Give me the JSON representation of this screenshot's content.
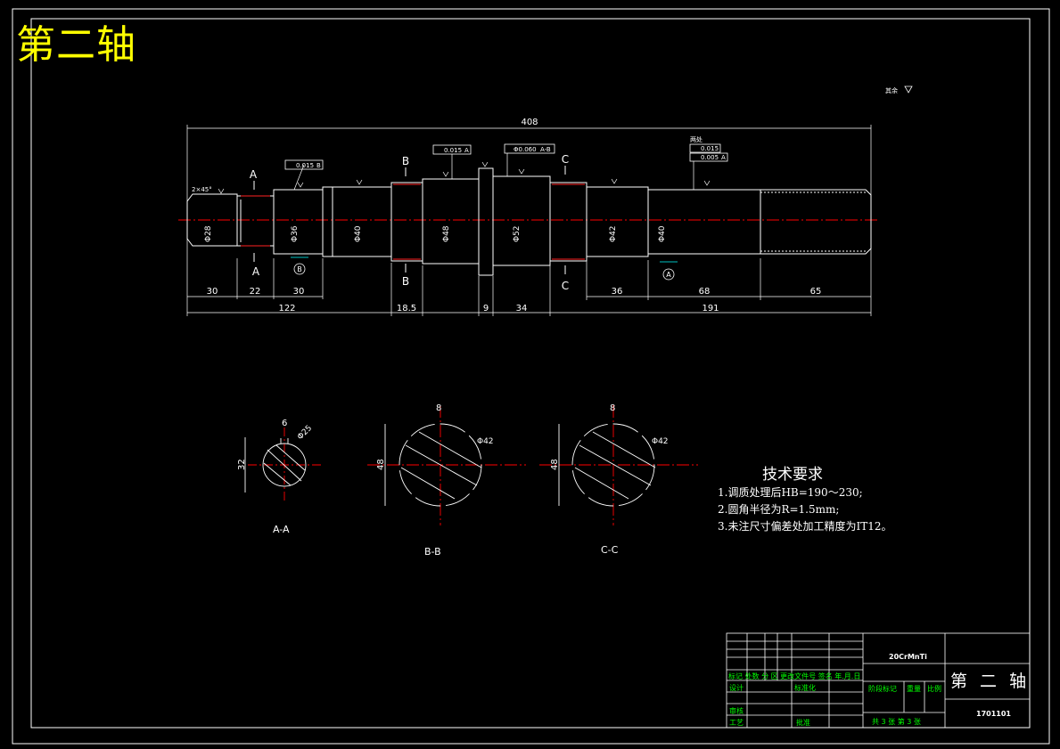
{
  "title": "第二轴",
  "roughness_note": "其余",
  "dims": {
    "overall": "408",
    "d1": "30",
    "d2": "22",
    "d3": "30",
    "d4": "122",
    "d5": "18.5",
    "d6": "9",
    "d7": "34",
    "d8": "36",
    "d9": "68",
    "d10": "65",
    "d11": "191"
  },
  "diameters": {
    "d28": "Φ28",
    "d36": "Φ36",
    "d40a": "Φ40",
    "d48": "Φ48",
    "d52": "Φ52",
    "d42": "Φ42",
    "d40b": "Φ40"
  },
  "section_marks": {
    "a": "A",
    "b": "B",
    "c": "C"
  },
  "tolerances": {
    "t1": "0.015",
    "t1_ref": "B",
    "t2": "0.015",
    "t2_ref": "A",
    "t3": "Φ0.060",
    "t3_ref": "A-B",
    "t4": "0.015",
    "t5": "0.005",
    "t5_ref": "A",
    "callout": "两处",
    "chamfer": "2×45°"
  },
  "datums": {
    "a": "A",
    "b": "B"
  },
  "sections": {
    "aa": {
      "label": "A-A",
      "height": "32",
      "width": "6",
      "dia": "Φ25"
    },
    "bb": {
      "label": "B-B",
      "height": "48",
      "width": "8",
      "dia": "Φ42"
    },
    "cc": {
      "label": "C-C",
      "height": "48",
      "width": "8",
      "dia": "Φ42"
    }
  },
  "tech_requirements": {
    "title": "技术要求",
    "items": [
      "1.调质处理后HB=190～230;",
      "2.圆角半径为R=1.5mm;",
      "3.未注尺寸偏差处加工精度为IT12。"
    ]
  },
  "title_block": {
    "material": "20CrMnTi",
    "name": "第 二 轴",
    "drawing_no": "1701101",
    "row1": "标记 处数 分 区 更改文件号 签名 年.月.日",
    "design": "设计",
    "standard": "标准化",
    "stage": "阶段标记",
    "weight": "重量",
    "scale": "比例",
    "review": "审核",
    "process": "工艺",
    "approve": "批准",
    "sheets": "共 3 张  第 3 张"
  },
  "colors": {
    "frame": "#ffffff",
    "title": "#ffff00",
    "centerline": "#ff0000",
    "tb_text": "#00ff00"
  }
}
